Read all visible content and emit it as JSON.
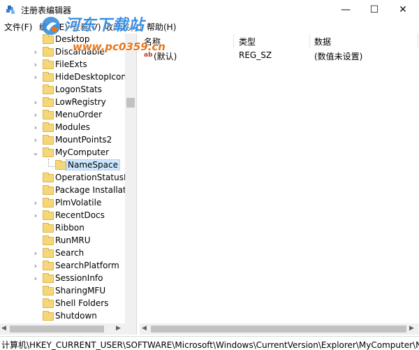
{
  "window": {
    "title": "注册表编辑器",
    "minimize_glyph": "—",
    "maximize_glyph": "☐",
    "close_glyph": "✕"
  },
  "menu": [
    "文件(F)",
    "编辑(E)",
    "查看(V)",
    "收藏夹(A)",
    "帮助(H)"
  ],
  "watermark": {
    "title": "河东下载站",
    "url": "www.pc0359.cn"
  },
  "tree": {
    "items": [
      {
        "label": "Desktop",
        "chevron": ""
      },
      {
        "label": "Discardable",
        "chevron": ">"
      },
      {
        "label": "FileExts",
        "chevron": ">"
      },
      {
        "label": "HideDesktopIcons",
        "chevron": ">"
      },
      {
        "label": "LogonStats",
        "chevron": ""
      },
      {
        "label": "LowRegistry",
        "chevron": ">"
      },
      {
        "label": "MenuOrder",
        "chevron": ">"
      },
      {
        "label": "Modules",
        "chevron": ">"
      },
      {
        "label": "MountPoints2",
        "chevron": ">"
      },
      {
        "label": "MyComputer",
        "chevron": "v"
      },
      {
        "label": "NameSpace",
        "chevron": "",
        "child": true,
        "selected": true
      },
      {
        "label": "OperationStatusMa",
        "chevron": ""
      },
      {
        "label": "Package Installatio",
        "chevron": ""
      },
      {
        "label": "PlmVolatile",
        "chevron": ">"
      },
      {
        "label": "RecentDocs",
        "chevron": ">"
      },
      {
        "label": "Ribbon",
        "chevron": ""
      },
      {
        "label": "RunMRU",
        "chevron": ""
      },
      {
        "label": "Search",
        "chevron": ">"
      },
      {
        "label": "SearchPlatform",
        "chevron": ">"
      },
      {
        "label": "SessionInfo",
        "chevron": ">"
      },
      {
        "label": "SharingMFU",
        "chevron": ""
      },
      {
        "label": "Shell Folders",
        "chevron": ""
      },
      {
        "label": "Shutdown",
        "chevron": ""
      }
    ]
  },
  "list": {
    "columns": [
      "名称",
      "类型",
      "数据"
    ],
    "rows": [
      {
        "name": "(默认)",
        "type": "REG_SZ",
        "data": "(数值未设置)",
        "icon": "ab"
      }
    ]
  },
  "status": {
    "path": "计算机\\HKEY_CURRENT_USER\\SOFTWARE\\Microsoft\\Windows\\CurrentVersion\\Explorer\\MyComputer\\NameSpace"
  },
  "colors": {
    "selection": "#cce8ff",
    "folder": "#f5d77a",
    "watermark_title": "#3a8fe0",
    "watermark_url": "#e8761a"
  }
}
